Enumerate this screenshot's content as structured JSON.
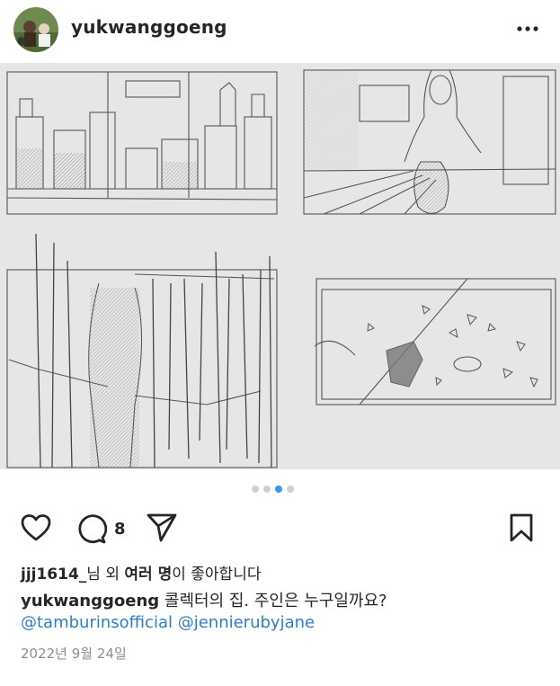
{
  "post": {
    "username": "yukwanggoeng",
    "more_icon": "more-horizontal-icon",
    "image_description": "pencil-sketch-storyboard",
    "carousel": {
      "count": 4,
      "active_index": 2
    },
    "actions": {
      "like_icon": "heart-icon",
      "comment_icon": "comment-icon",
      "comment_count": "8",
      "share_icon": "paper-plane-icon",
      "save_icon": "bookmark-icon"
    },
    "likes": {
      "user": "jjj1614_",
      "text1": "님 외 ",
      "bold": "여러 명",
      "text2": "이 좋아합니다"
    },
    "caption": {
      "user": "yukwanggoeng",
      "text": "콜렉터의 집. 주인은 누구일까요?"
    },
    "mentions": "@tamburinsofficial @jennierubyjane",
    "date": "2022년 9월 24일"
  }
}
